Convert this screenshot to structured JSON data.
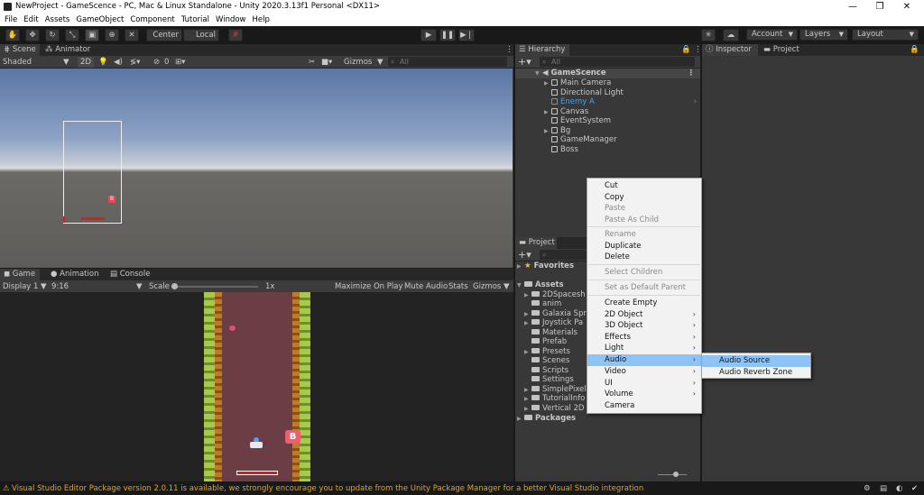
{
  "window": {
    "title": "NewProject - GameScence - PC, Mac & Linux Standalone - Unity 2020.3.13f1 Personal <DX11>",
    "minimize": "—",
    "maximize": "❐",
    "close": "✕"
  },
  "menubar": [
    "File",
    "Edit",
    "Assets",
    "GameObject",
    "Component",
    "Tutorial",
    "Window",
    "Help"
  ],
  "toolbar": {
    "pivot_label": "Center",
    "space_label": "Local",
    "account_label": "Account",
    "layers_label": "Layers",
    "layout_label": "Layout"
  },
  "scene_panel": {
    "tabs": [
      "Scene",
      "Animator"
    ],
    "shading": "Shaded",
    "mode_2d": "2D",
    "fx_count": "0",
    "gizmos": "Gizmos",
    "search_placeholder": "All"
  },
  "game_panel": {
    "tabs": [
      "Game",
      "Animation",
      "Console"
    ],
    "display": "Display 1",
    "aspect": "9:16",
    "scale_label": "Scale",
    "scale_value": "1x",
    "maximize_on_play": "Maximize On Play",
    "mute_audio": "Mute Audio",
    "stats": "Stats",
    "gizmos": "Gizmos",
    "boss_badge": "B"
  },
  "scene_badge": "B",
  "hierarchy": {
    "tab": "Hierarchy",
    "search_placeholder": "All",
    "scene": "GameScence",
    "items": [
      "Main Camera",
      "Directional Light",
      "Enemy A",
      "Canvas",
      "EventSystem",
      "Bg",
      "GameManager",
      "Boss"
    ]
  },
  "project": {
    "tab": "Project",
    "favorites": "Favorites",
    "assets": "Assets",
    "folders": [
      "2DSpacesh",
      "anim",
      "Galaxia Spr",
      "Joystick Pa",
      "Materials",
      "Prefab",
      "Presets",
      "Scenes",
      "Scripts",
      "Settings",
      "SimplePixel",
      "TutorialInfo",
      "Vertical 2D"
    ],
    "packages": "Packages"
  },
  "inspector": {
    "tabs": [
      "Inspector",
      "Project"
    ]
  },
  "context_menu": {
    "items": [
      "Cut",
      "Copy",
      "Paste",
      "Paste As Child",
      "Rename",
      "Duplicate",
      "Delete",
      "Select Children",
      "Set as Default Parent",
      "Create Empty",
      "2D Object",
      "3D Object",
      "Effects",
      "Light",
      "Audio",
      "Video",
      "UI",
      "Volume",
      "Camera"
    ]
  },
  "submenu": {
    "items": [
      "Audio Source",
      "Audio Reverb Zone"
    ]
  },
  "status": {
    "message": "Visual Studio Editor Package version 2.0.11 is available, we strongly encourage you to update from the Unity Package Manager for a better Visual Studio integration"
  },
  "colors": {
    "accent_highlight": "#8ec3f5",
    "selected_item": "#4d9ee6",
    "warning": "#e8a800"
  }
}
